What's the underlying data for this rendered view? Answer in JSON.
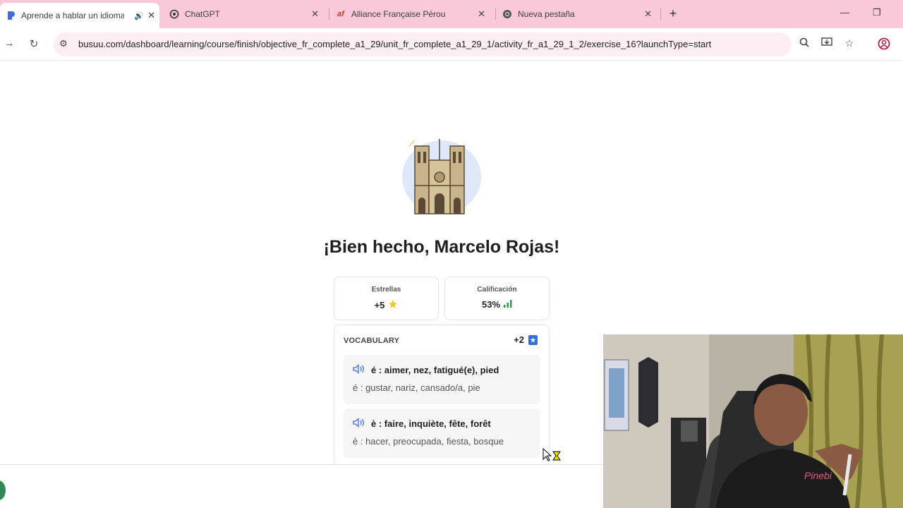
{
  "browser": {
    "tabs": [
      {
        "title": "Aprende a hablar un idioma",
        "favicon": "busuu-icon",
        "active": true,
        "audio": true
      },
      {
        "title": "ChatGPT",
        "favicon": "chatgpt-icon",
        "active": false
      },
      {
        "title": "Alliance Française Pérou",
        "favicon": "af-icon",
        "active": false
      },
      {
        "title": "Nueva pestaña",
        "favicon": "chrome-icon",
        "active": false
      }
    ],
    "url": "busuu.com/dashboard/learning/course/finish/objective_fr_complete_a1_29/unit_fr_complete_a1_29_1/activity_fr_a1_29_1_2/exercise_16?launchType=start"
  },
  "page": {
    "heading": "¡Bien hecho, Marcelo Rojas!",
    "stats": [
      {
        "label": "Estrellas",
        "value": "+5",
        "icon": "star-icon"
      },
      {
        "label": "Calificación",
        "value": "53%",
        "icon": "bar-chart-icon"
      }
    ],
    "vocabulary": {
      "title": "VOCABULARY",
      "bonus": "+2",
      "items": [
        {
          "french": "é : aimer, nez, fatigué(e), pied",
          "spanish": "é : gustar, nariz, cansado/a, pie"
        },
        {
          "french": "è : faire, inquiète, fête, forêt",
          "spanish": "è : hacer, preocupada, fiesta, bosque"
        }
      ]
    }
  },
  "colors": {
    "tab_strip": "#f9c9d9",
    "omnibox": "#fdeef3",
    "accent_blue": "#2f6fe0",
    "star": "#f5c518",
    "chart_green": "#2e9e4f"
  }
}
